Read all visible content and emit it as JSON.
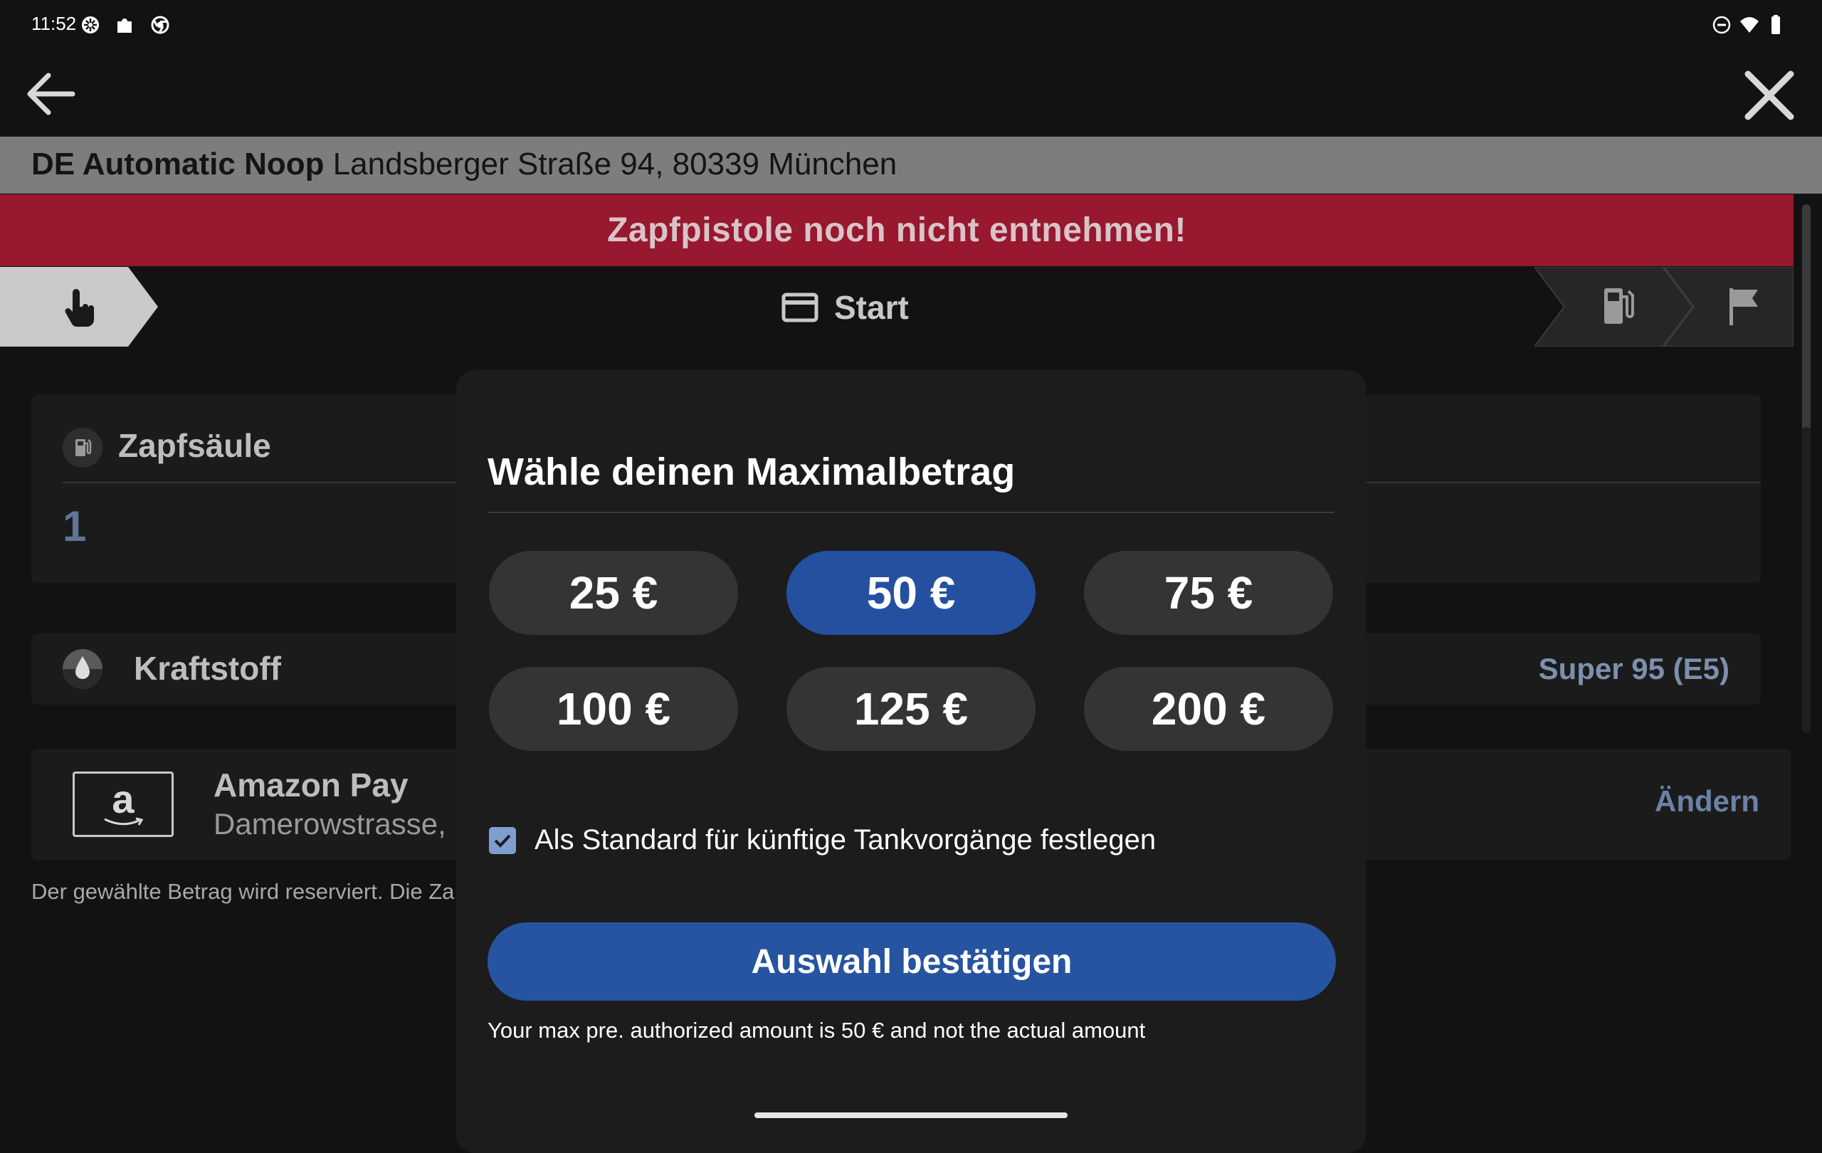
{
  "status_bar": {
    "time": "11:52"
  },
  "station": {
    "name": "DE Automatic Noop",
    "address": "Landsberger Straße 94, 80339 München"
  },
  "warning": "Zapfpistole noch nicht entnehmen!",
  "steps": {
    "current_label": "Start"
  },
  "pump_card": {
    "title": "Zapfsäule",
    "value": "1"
  },
  "fuel_card": {
    "title": "Kraftstoff",
    "value": "Super 95 (E5)"
  },
  "payment_card": {
    "method": "Amazon Pay",
    "address": "Damerowstrasse,",
    "change_label": "Ändern",
    "logo_letter": "a"
  },
  "footnote": "Der gewählte Betrag wird reserviert. Die Za",
  "modal": {
    "title": "Wähle deinen Maximalbetrag",
    "amounts": [
      {
        "label": "25 €",
        "selected": false
      },
      {
        "label": "50 €",
        "selected": true
      },
      {
        "label": "75 €",
        "selected": false
      },
      {
        "label": "100 €",
        "selected": false
      },
      {
        "label": "125 €",
        "selected": false
      },
      {
        "label": "200 €",
        "selected": false
      }
    ],
    "default_checkbox": {
      "label": "Als Standard für künftige Tankvorgänge festlegen",
      "checked": true
    },
    "confirm_label": "Auswahl bestätigen",
    "info": "Your max pre. authorized amount is 50 € and not the actual amount"
  },
  "colors": {
    "accent": "#2654a0",
    "warning_bg": "#97182f",
    "station_bar": "#7d7d7d",
    "background": "#121212"
  }
}
